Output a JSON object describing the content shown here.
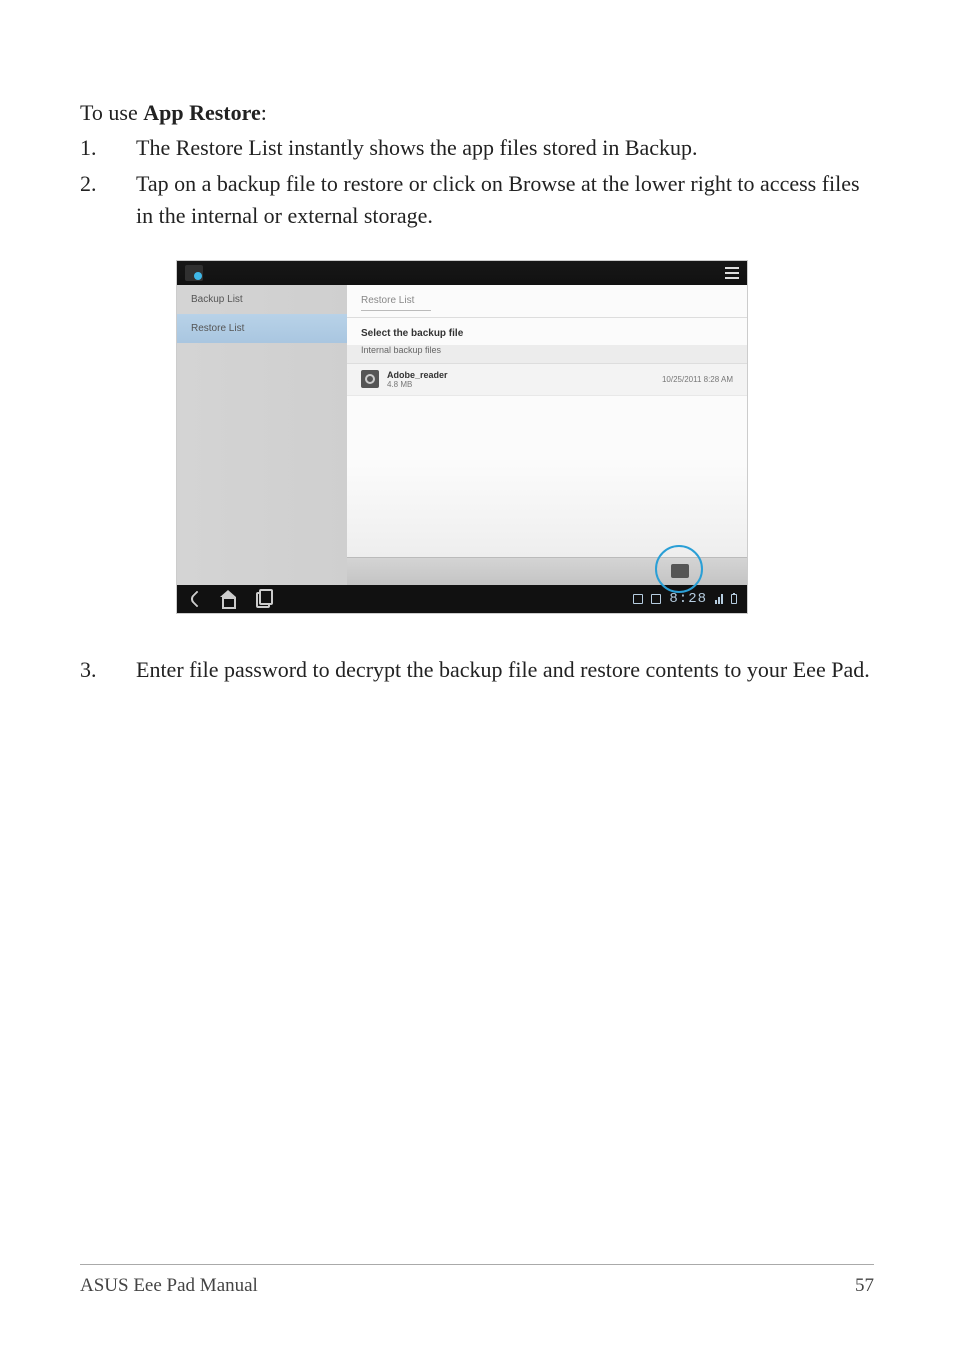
{
  "heading": {
    "prefix": "To use ",
    "bold": "App Restore",
    "suffix": ":"
  },
  "steps": {
    "s1": {
      "num": "1.",
      "text": "The Restore List instantly shows the app files stored in Backup."
    },
    "s2": {
      "num": "2.",
      "text": "Tap on a backup file to restore or click on Browse at the lower right to access files in the internal or external storage."
    },
    "s3": {
      "num": "3.",
      "text": "Enter file password to decrypt the backup file and restore contents to your Eee Pad."
    }
  },
  "screenshot": {
    "sidebar": {
      "backup": "Backup List",
      "restore": "Restore List"
    },
    "main": {
      "title": "Restore List",
      "section_heading": "Select the backup file",
      "section_sub": "Internal backup files",
      "file": {
        "name": "Adobe_reader",
        "size": "4.8 MB",
        "date": "10/25/2011 8:28 AM"
      }
    },
    "navbar": {
      "time": "8:28"
    }
  },
  "footer": {
    "left": "ASUS Eee Pad Manual",
    "right": "57"
  }
}
